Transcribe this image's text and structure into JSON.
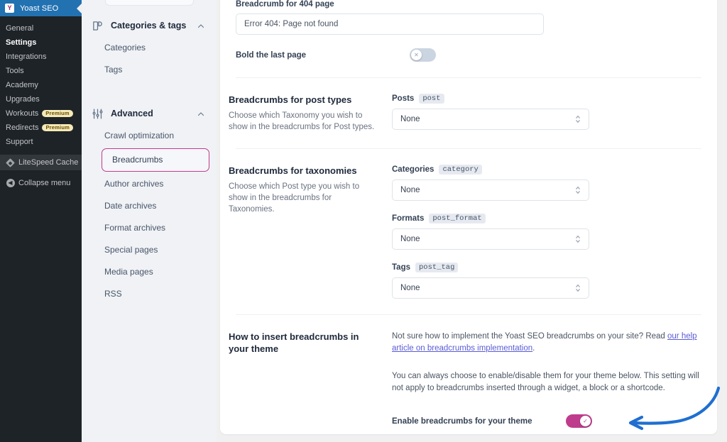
{
  "wp_sidebar": {
    "brand": {
      "label": "Yoast SEO",
      "mark": "Y"
    },
    "items": [
      {
        "label": "General",
        "badge": null,
        "active": false
      },
      {
        "label": "Settings",
        "badge": null,
        "active": true
      },
      {
        "label": "Integrations",
        "badge": null,
        "active": false
      },
      {
        "label": "Tools",
        "badge": null,
        "active": false
      },
      {
        "label": "Academy",
        "badge": null,
        "active": false
      },
      {
        "label": "Upgrades",
        "badge": null,
        "active": false
      },
      {
        "label": "Workouts",
        "badge": "Premium",
        "active": false
      },
      {
        "label": "Redirects",
        "badge": "Premium",
        "active": false
      },
      {
        "label": "Support",
        "badge": null,
        "active": false
      }
    ],
    "plugin_item": {
      "label": "LiteSpeed Cache"
    },
    "collapse_item": {
      "label": "Collapse menu"
    }
  },
  "yoast_nav": {
    "groups": [
      {
        "title": "Categories & tags",
        "icon": "tags-icon",
        "items": [
          {
            "label": "Categories",
            "selected": false
          },
          {
            "label": "Tags",
            "selected": false
          }
        ]
      },
      {
        "title": "Advanced",
        "icon": "sliders-icon",
        "items": [
          {
            "label": "Crawl optimization",
            "selected": false
          },
          {
            "label": "Breadcrumbs",
            "selected": true
          },
          {
            "label": "Author archives",
            "selected": false
          },
          {
            "label": "Date archives",
            "selected": false
          },
          {
            "label": "Format archives",
            "selected": false
          },
          {
            "label": "Special pages",
            "selected": false
          },
          {
            "label": "Media pages",
            "selected": false
          },
          {
            "label": "RSS",
            "selected": false
          }
        ]
      }
    ]
  },
  "main": {
    "breadcrumb_404": {
      "label": "Breadcrumb for 404 page",
      "value": "Error 404: Page not found",
      "placeholder": ""
    },
    "bold_last_page": {
      "label": "Bold the last page",
      "state": "off",
      "knob_glyph": "✕"
    },
    "post_types_section": {
      "title": "Breadcrumbs for post types",
      "desc": "Choose which Taxonomy you wish to show in the breadcrumbs for Post types.",
      "selects": [
        {
          "name": "Posts",
          "code": "post",
          "value": "None"
        }
      ]
    },
    "taxonomies_section": {
      "title": "Breadcrumbs for taxonomies",
      "desc": "Choose which Post type you wish to show in the breadcrumbs for Taxonomies.",
      "selects": [
        {
          "name": "Categories",
          "code": "category",
          "value": "None"
        },
        {
          "name": "Formats",
          "code": "post_format",
          "value": "None"
        },
        {
          "name": "Tags",
          "code": "post_tag",
          "value": "None"
        }
      ]
    },
    "insert_section": {
      "title": "How to insert breadcrumbs in your theme",
      "paragraph1_before": "Not sure how to implement the Yoast SEO breadcrumbs on your site? Read ",
      "paragraph1_link": "our help article on breadcrumbs implementation",
      "paragraph1_after": ".",
      "paragraph2": "You can always choose to enable/disable them for your theme below. This setting will not apply to breadcrumbs inserted through a widget, a block or a shortcode.",
      "enable_toggle": {
        "label": "Enable breadcrumbs for your theme",
        "state": "on",
        "knob_glyph": "✓"
      }
    }
  },
  "colors": {
    "wp_sidebar_bg": "#1d2327",
    "wp_brand_bg": "#2271b1",
    "accent_pink": "#bf3c8c",
    "link_purple": "#5b5bd6",
    "annotation_blue": "#1f6fd0",
    "premium_badge_bg": "#f5e9b8"
  }
}
